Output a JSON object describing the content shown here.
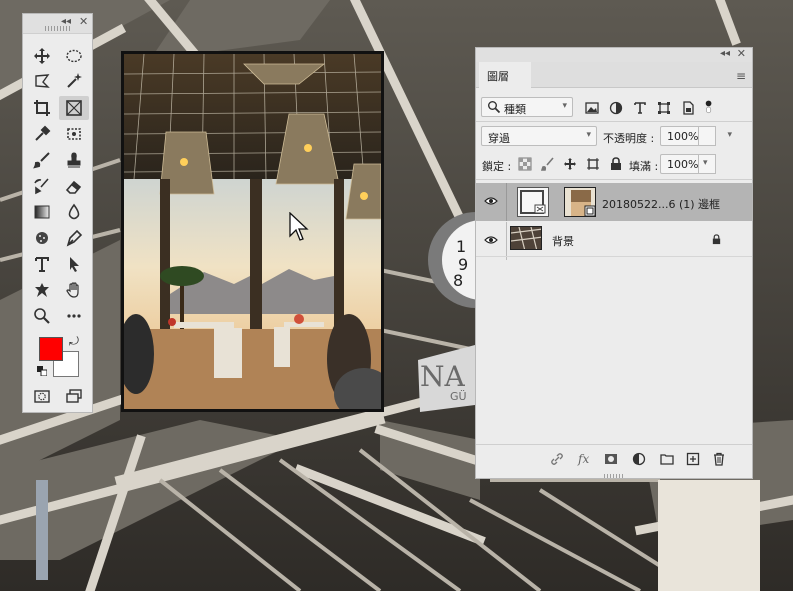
{
  "tools_panel": {
    "collapse_icon": "double-chevron-left-icon",
    "close_icon": "close-icon",
    "foreground_color": "#ff0000",
    "background_color": "#ffffff"
  },
  "layers_panel": {
    "tab_label": "圖層",
    "filter": {
      "value": "種類"
    },
    "blend_mode": {
      "value": "穿過"
    },
    "opacity": {
      "label": "不透明度 :",
      "value": "100%"
    },
    "lock": {
      "label": "鎖定 :"
    },
    "fill": {
      "label": "填滿 :",
      "value": "100%"
    },
    "layers": [
      {
        "name": "20180522...6 (1) 邊框",
        "selected": true,
        "visible": true
      },
      {
        "name": "背景",
        "selected": false,
        "visible": true,
        "locked": true
      }
    ]
  }
}
